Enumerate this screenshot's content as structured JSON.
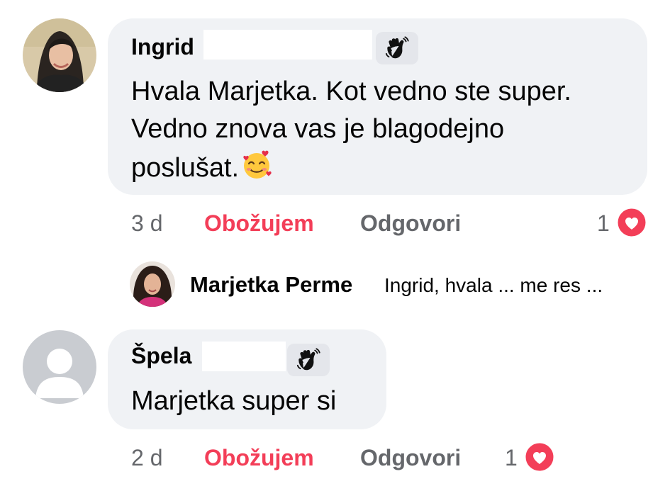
{
  "comments": [
    {
      "author": "Ingrid",
      "badge_icon": "wave-hand-icon",
      "text_lines": [
        "Hvala Marjetka. Kot vedno ste super.",
        "Vedno znova vas je blagodejno",
        "poslušat."
      ],
      "emoji": "smiling-face-with-hearts",
      "time": "3 d",
      "love_label": "Obožujem",
      "reply_label": "Odgovori",
      "reaction_count": "1",
      "reaction_icon": "heart-icon"
    },
    {
      "author": "Špela",
      "badge_icon": "wave-hand-icon",
      "text_lines": [
        "Marjetka super si"
      ],
      "time": "2 d",
      "love_label": "Obožujem",
      "reply_label": "Odgovori",
      "reaction_count": "1",
      "reaction_icon": "heart-icon"
    }
  ],
  "reply_preview": {
    "author": "Marjetka Perme",
    "snippet": "Ingrid, hvala ... me res ..."
  },
  "colors": {
    "bubble": "#f0f2f5",
    "love": "#f33e58",
    "muted": "#65676b",
    "text": "#050505"
  }
}
